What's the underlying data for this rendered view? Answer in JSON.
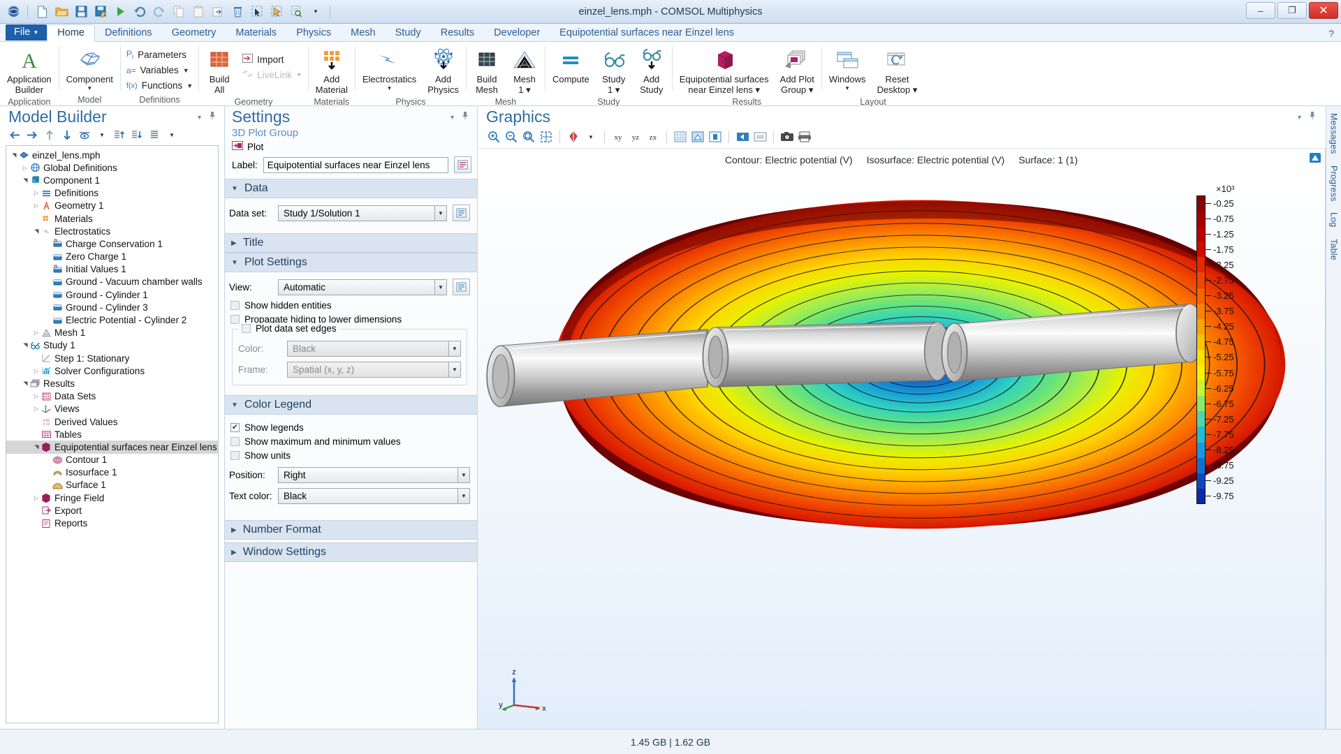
{
  "window": {
    "title": "einzel_lens.mph - COMSOL Multiphysics",
    "minimize": "–",
    "maximize": "❐",
    "close": "✕"
  },
  "quick_access": {
    "icons": [
      "comsol-logo-icon",
      "new-file-icon",
      "open-folder-icon",
      "save-icon",
      "save-as-icon",
      "run-icon",
      "undo-icon",
      "redo-icon",
      "copy-icon",
      "paste-icon",
      "duplicate-icon",
      "delete-icon",
      "select-box-icon",
      "select-pointer-icon",
      "zoom-to-selection-icon",
      "more-options-caret-icon"
    ]
  },
  "ribbon": {
    "file_tab": "File",
    "tabs": [
      "Home",
      "Definitions",
      "Geometry",
      "Materials",
      "Physics",
      "Mesh",
      "Study",
      "Results",
      "Developer",
      "Equipotential surfaces near Einzel lens"
    ],
    "active_tab": "Home",
    "help_icon": "?",
    "groups": [
      {
        "name": "Application",
        "label": "Application",
        "buttons": [
          {
            "label_l1": "Application",
            "label_l2": "Builder",
            "icon": "application-builder-icon"
          }
        ]
      },
      {
        "name": "Model",
        "label": "Model",
        "buttons": [
          {
            "label_l1": "Component",
            "label_l2": "▾",
            "icon": "component-icon"
          }
        ]
      },
      {
        "name": "Definitions",
        "label": "Definitions",
        "small": [
          {
            "label": "Parameters",
            "icon": "parameters-icon",
            "caret": false,
            "dim": false
          },
          {
            "label": "Variables",
            "icon": "variables-icon",
            "caret": true,
            "dim": false
          },
          {
            "label": "Functions",
            "icon": "functions-icon",
            "caret": true,
            "dim": false
          }
        ]
      },
      {
        "name": "Geometry",
        "label": "Geometry",
        "buttons": [
          {
            "label_l1": "Build",
            "label_l2": "All",
            "icon": "build-all-icon"
          }
        ],
        "small": [
          {
            "label": "Import",
            "icon": "import-icon",
            "caret": false,
            "dim": false
          },
          {
            "label": "LiveLink",
            "icon": "livelink-icon",
            "caret": true,
            "dim": true
          }
        ]
      },
      {
        "name": "Materials",
        "label": "Materials",
        "buttons": [
          {
            "label_l1": "Add",
            "label_l2": "Material",
            "icon": "add-material-icon"
          }
        ]
      },
      {
        "name": "Physics",
        "label": "Physics",
        "buttons": [
          {
            "label_l1": "Electrostatics",
            "label_l2": "▾",
            "icon": "electrostatics-icon"
          },
          {
            "label_l1": "Add",
            "label_l2": "Physics",
            "icon": "add-physics-icon"
          }
        ]
      },
      {
        "name": "Mesh",
        "label": "Mesh",
        "buttons": [
          {
            "label_l1": "Build",
            "label_l2": "Mesh",
            "icon": "build-mesh-icon"
          },
          {
            "label_l1": "Mesh",
            "label_l2": "1 ▾",
            "icon": "mesh-icon"
          }
        ]
      },
      {
        "name": "Study",
        "label": "Study",
        "buttons": [
          {
            "label_l1": "Compute",
            "label_l2": "",
            "icon": "compute-icon"
          },
          {
            "label_l1": "Study",
            "label_l2": "1 ▾",
            "icon": "study-icon"
          },
          {
            "label_l1": "Add",
            "label_l2": "Study",
            "icon": "add-study-icon"
          }
        ]
      },
      {
        "name": "Results",
        "label": "Results",
        "buttons": [
          {
            "label_l1": "Equipotential surfaces",
            "label_l2": "near Einzel lens ▾",
            "icon": "plot-group-3d-icon"
          },
          {
            "label_l1": "Add Plot",
            "label_l2": "Group ▾",
            "icon": "add-plot-group-icon"
          }
        ]
      },
      {
        "name": "Layout",
        "label": "Layout",
        "buttons": [
          {
            "label_l1": "Windows",
            "label_l2": "▾",
            "icon": "windows-icon"
          },
          {
            "label_l1": "Reset",
            "label_l2": "Desktop ▾",
            "icon": "reset-desktop-icon"
          }
        ]
      }
    ]
  },
  "model_builder": {
    "title": "Model Builder",
    "collapse_icon": "chevron-down-icon",
    "pin_icon": "pin-icon",
    "toolbar_icons": [
      "back-icon",
      "forward-icon",
      "move-up-icon",
      "move-down-icon",
      "show-icon",
      "show-caret-icon",
      "expand-tree-icon",
      "collapse-tree-icon",
      "tree-options-icon",
      "tree-options-caret-icon"
    ],
    "tree": [
      {
        "label": "einzel_lens.mph",
        "depth": 0,
        "exp": "down",
        "icon": "model-root-icon",
        "sel": false
      },
      {
        "label": "Global Definitions",
        "depth": 1,
        "exp": "right",
        "icon": "globe-icon",
        "sel": false
      },
      {
        "label": "Component 1",
        "depth": 1,
        "exp": "down",
        "icon": "component-node-icon",
        "sel": false
      },
      {
        "label": "Definitions",
        "depth": 2,
        "exp": "right",
        "icon": "definitions-icon",
        "sel": false
      },
      {
        "label": "Geometry 1",
        "depth": 2,
        "exp": "right",
        "icon": "geometry-icon",
        "sel": false
      },
      {
        "label": "Materials",
        "depth": 2,
        "exp": "none",
        "icon": "materials-icon",
        "sel": false
      },
      {
        "label": "Electrostatics",
        "depth": 2,
        "exp": "down",
        "icon": "electrostatics-node-icon",
        "sel": false
      },
      {
        "label": "Charge Conservation 1",
        "depth": 3,
        "exp": "none",
        "icon": "domain-node-icon",
        "sel": false
      },
      {
        "label": "Zero Charge 1",
        "depth": 3,
        "exp": "none",
        "icon": "boundary-node-icon",
        "sel": false
      },
      {
        "label": "Initial Values 1",
        "depth": 3,
        "exp": "none",
        "icon": "domain-node-icon",
        "sel": false
      },
      {
        "label": "Ground - Vacuum chamber walls",
        "depth": 3,
        "exp": "none",
        "icon": "boundary-node-icon",
        "sel": false
      },
      {
        "label": "Ground - Cylinder 1",
        "depth": 3,
        "exp": "none",
        "icon": "boundary-node-icon",
        "sel": false
      },
      {
        "label": "Ground - Cylinder 3",
        "depth": 3,
        "exp": "none",
        "icon": "boundary-node-icon",
        "sel": false
      },
      {
        "label": "Electric Potential - Cylinder 2",
        "depth": 3,
        "exp": "none",
        "icon": "boundary-node-icon",
        "sel": false
      },
      {
        "label": "Mesh 1",
        "depth": 2,
        "exp": "right",
        "icon": "mesh-node-icon",
        "sel": false
      },
      {
        "label": "Study 1",
        "depth": 1,
        "exp": "down",
        "icon": "study-node-icon",
        "sel": false
      },
      {
        "label": "Step 1: Stationary",
        "depth": 2,
        "exp": "none",
        "icon": "stationary-step-icon",
        "sel": false
      },
      {
        "label": "Solver Configurations",
        "depth": 2,
        "exp": "right",
        "icon": "solver-icon",
        "sel": false
      },
      {
        "label": "Results",
        "depth": 1,
        "exp": "down",
        "icon": "results-icon",
        "sel": false
      },
      {
        "label": "Data Sets",
        "depth": 2,
        "exp": "right",
        "icon": "data-sets-icon",
        "sel": false
      },
      {
        "label": "Views",
        "depth": 2,
        "exp": "right",
        "icon": "views-icon",
        "sel": false
      },
      {
        "label": "Derived Values",
        "depth": 2,
        "exp": "none",
        "icon": "derived-values-icon",
        "sel": false
      },
      {
        "label": "Tables",
        "depth": 2,
        "exp": "none",
        "icon": "tables-icon",
        "sel": false
      },
      {
        "label": "Equipotential surfaces near Einzel lens",
        "depth": 2,
        "exp": "down",
        "icon": "plot-group-3d-node-icon",
        "sel": true
      },
      {
        "label": "Contour 1",
        "depth": 3,
        "exp": "none",
        "icon": "contour-icon",
        "sel": false
      },
      {
        "label": "Isosurface 1",
        "depth": 3,
        "exp": "none",
        "icon": "isosurface-icon",
        "sel": false
      },
      {
        "label": "Surface 1",
        "depth": 3,
        "exp": "none",
        "icon": "surface-icon",
        "sel": false
      },
      {
        "label": "Fringe Field",
        "depth": 2,
        "exp": "right",
        "icon": "plot-group-3d-node-icon",
        "sel": false
      },
      {
        "label": "Export",
        "depth": 2,
        "exp": "none",
        "icon": "export-icon",
        "sel": false
      },
      {
        "label": "Reports",
        "depth": 2,
        "exp": "none",
        "icon": "reports-icon",
        "sel": false
      }
    ]
  },
  "settings": {
    "title": "Settings",
    "subtitle": "3D Plot Group",
    "plot_button": "Plot",
    "plot_icon": "plot-icon",
    "collapse_icon": "chevron-down-icon",
    "pin_icon": "pin-icon",
    "label_field": {
      "label": "Label:",
      "value": "Equipotential surfaces near Einzel lens",
      "button_icon": "rename-icon"
    },
    "sections": {
      "data": {
        "title": "Data",
        "expanded": true,
        "data_set": {
          "label": "Data set:",
          "value": "Study 1/Solution 1",
          "button_icon": "goto-source-icon"
        }
      },
      "title_section": {
        "title": "Title",
        "expanded": false
      },
      "plot_settings": {
        "title": "Plot Settings",
        "expanded": true,
        "view": {
          "label": "View:",
          "value": "Automatic",
          "button_icon": "goto-source-icon"
        },
        "show_hidden_entities": {
          "label": "Show hidden entities",
          "checked": false
        },
        "propagate_hiding": {
          "label": "Propagate hiding to lower dimensions",
          "checked": false
        },
        "plot_data_set_edges": {
          "label": "Plot data set edges",
          "checked": false
        },
        "color": {
          "label": "Color:",
          "value": "Black"
        },
        "frame": {
          "label": "Frame:",
          "value": "Spatial  (x, y, z)"
        }
      },
      "color_legend": {
        "title": "Color Legend",
        "expanded": true,
        "show_legends": {
          "label": "Show legends",
          "checked": true
        },
        "show_max_min": {
          "label": "Show maximum and minimum values",
          "checked": false
        },
        "show_units": {
          "label": "Show units",
          "checked": false
        },
        "position": {
          "label": "Position:",
          "value": "Right"
        },
        "text_color": {
          "label": "Text color:",
          "value": "Black"
        }
      },
      "number_format": {
        "title": "Number Format",
        "expanded": false
      },
      "window_settings": {
        "title": "Window Settings",
        "expanded": false
      }
    }
  },
  "graphics": {
    "title": "Graphics",
    "collapse_icon": "chevron-down-icon",
    "pin_icon": "pin-icon",
    "toolbar_icons": [
      "zoom-in-icon",
      "zoom-out-icon",
      "zoom-extents-icon",
      "zoom-box-icon",
      "transparency-icon",
      "transparency-caret-icon",
      "view-xy-icon",
      "view-yz-icon",
      "view-zx-icon",
      "grid-icon",
      "orthographic-icon",
      "perspective-icon",
      "scene-light-icon",
      "select-all-icon",
      "snapshot-icon",
      "print-icon"
    ],
    "caption_parts": [
      "Contour: Electric potential (V)",
      "Isosurface: Electric potential (V)",
      "Surface: 1 (1)"
    ],
    "watermark_icon": "comsol-watermark-icon",
    "axis_triad": {
      "x": "x",
      "y": "y",
      "z": "z"
    }
  },
  "right_dock": [
    "Messages",
    "Progress",
    "Log",
    "Table"
  ],
  "status_bar": {
    "memory": "1.45 GB | 1.62 GB"
  },
  "chart_data": {
    "type": "heatmap",
    "title": "Contour: Electric potential (V)   Isosurface: Electric potential (V)   Surface: 1 (1)",
    "colorbar": {
      "exponent_label": "×10³",
      "unit": "V",
      "position": "right",
      "ticks": [
        -0.25,
        -0.75,
        -1.25,
        -1.75,
        -2.25,
        -2.75,
        -3.25,
        -3.75,
        -4.25,
        -4.75,
        -5.25,
        -5.75,
        -6.25,
        -6.75,
        -7.25,
        -7.75,
        -8.25,
        -8.75,
        -9.25,
        -9.75
      ],
      "tick_labels": [
        "-0.25",
        "-0.75",
        "-1.25",
        "-1.75",
        "-2.25",
        "-2.75",
        "-3.25",
        "-3.75",
        "-4.25",
        "-4.75",
        "-5.25",
        "-5.75",
        "-6.25",
        "-6.75",
        "-7.25",
        "-7.75",
        "-8.25",
        "-8.75",
        "-9.25",
        "-9.75"
      ],
      "colors": [
        "#8a0000",
        "#a40000",
        "#bc0000",
        "#d10b00",
        "#e62800",
        "#f04500",
        "#f86300",
        "#fb8300",
        "#fda300",
        "#fec200",
        "#ffe000",
        "#f4f400",
        "#c8f432",
        "#8ae86c",
        "#4fd6a8",
        "#22bcd4",
        "#1898e0",
        "#1470d0",
        "#1048bc",
        "#0a2aa8"
      ],
      "range": [
        -9.75,
        -0.25
      ]
    },
    "xlabel": "x",
    "ylabel": "y",
    "zlabel": "z",
    "description": "3D equipotential contour/isosurface plot of electric potential around an einzel lens consisting of three coaxial cylindrical electrodes"
  }
}
